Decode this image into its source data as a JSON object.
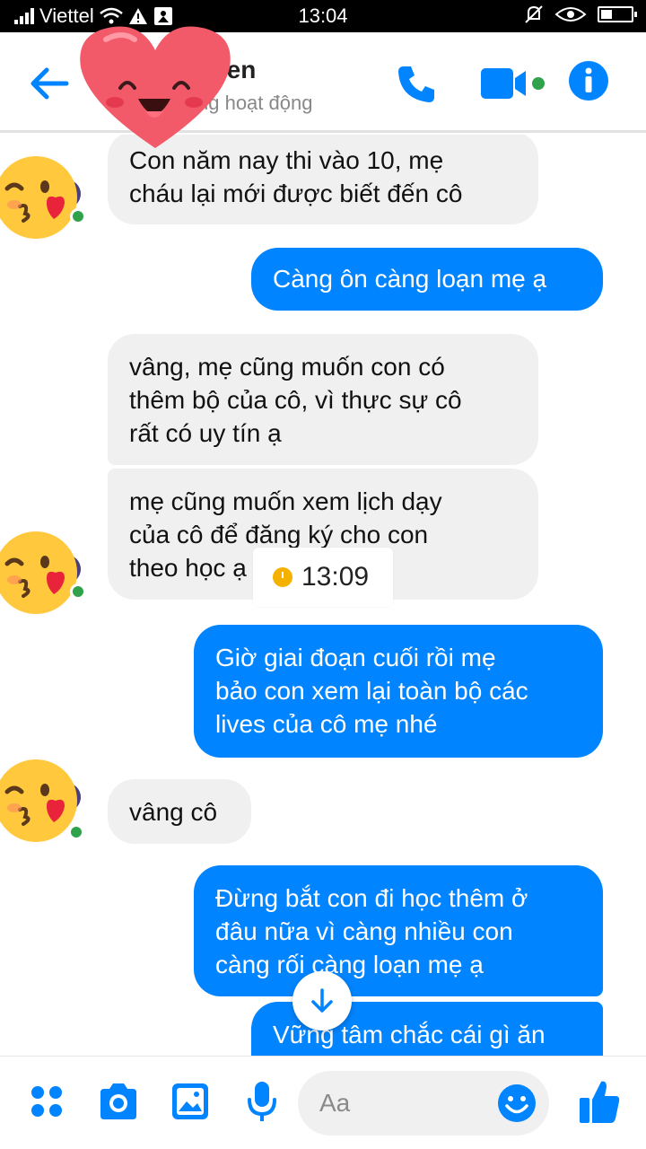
{
  "status_bar": {
    "carrier": "Viettel",
    "time": "13:04"
  },
  "header": {
    "contact_name": "uyen",
    "contact_status": "ng hoạt động",
    "accent_color": "#0084ff"
  },
  "messages": [
    {
      "direction": "incoming",
      "text_lines": [
        "Con năm nay thi vào 10, mẹ",
        "cháu lại mới được biết đến cô"
      ]
    },
    {
      "direction": "outgoing",
      "text_lines": [
        "Càng ôn càng loạn mẹ ạ"
      ]
    },
    {
      "direction": "incoming",
      "text_lines": [
        "vâng, mẹ cũng muốn con  có",
        "thêm bộ của cô, vì thực sự cô",
        "rất có uy tín ạ"
      ]
    },
    {
      "direction": "incoming",
      "text_lines": [
        "mẹ cũng muốn xem lịch dạy",
        "của cô để đăng ký cho con",
        "theo học ạ"
      ]
    },
    {
      "direction": "outgoing",
      "text_lines": [
        "Giờ giai đoạn cuối rồi mẹ",
        "bảo con xem lại toàn bộ các",
        "lives của cô mẹ nhé"
      ]
    },
    {
      "direction": "incoming",
      "text_lines": [
        "vâng cô"
      ]
    },
    {
      "direction": "outgoing",
      "text_lines": [
        "Đừng bắt con đi học thêm ở",
        "đâu nữa vì càng nhiều con",
        "càng rối càng loạn mẹ ạ"
      ]
    },
    {
      "direction": "outgoing",
      "text_lines": [
        "Vững tâm chắc cái gì ăn"
      ]
    }
  ],
  "overlay_timestamp": "13:09",
  "composer": {
    "placeholder": "Aa"
  },
  "icons": [
    "back-arrow-icon",
    "phone-icon",
    "video-camera-icon",
    "info-icon",
    "apps-grid-icon",
    "camera-icon",
    "image-icon",
    "microphone-icon",
    "emoji-icon",
    "thumbs-up-icon",
    "arrow-down-icon",
    "heart-sticker",
    "kiss-emoji-avatar"
  ]
}
